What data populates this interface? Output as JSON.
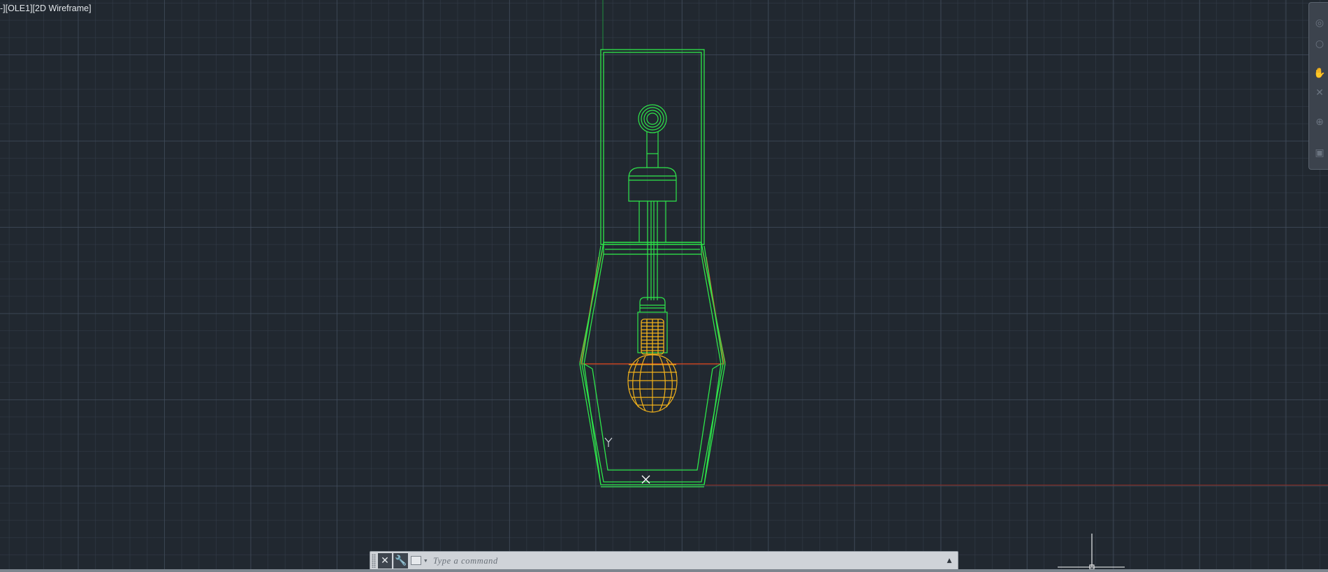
{
  "viewport": {
    "label": "-][OLE1][2D Wireframe]",
    "colors": {
      "background": "#212830",
      "grid_major": "#465262",
      "grid_minor": "#343d4a",
      "fixture_green": "#2ee64a",
      "shade_red": "#e5471e",
      "bulb_yellow": "#f2b21b",
      "crosshair": "#ffffff"
    }
  },
  "drawing": {
    "objects": [
      "wall-plate",
      "stem-fitting",
      "lamp-shade",
      "bulb-socket",
      "bulb",
      "ucs-icon",
      "cursor-crosshair"
    ]
  },
  "navigation_bar": {
    "icons": [
      "steering-wheel-icon",
      "orbit-icon",
      "pan-icon",
      "zoom-icon",
      "orbit-3d-icon",
      "showmotion-icon"
    ]
  },
  "command_line": {
    "placeholder": "Type a command",
    "close_icon": "✕",
    "customize_icon": "🔧",
    "history_icon": "▲"
  }
}
